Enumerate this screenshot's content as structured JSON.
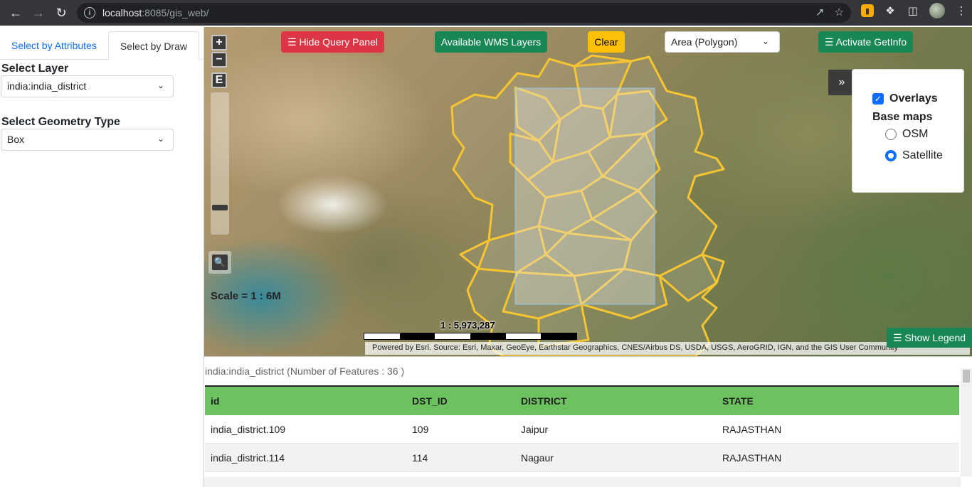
{
  "browser": {
    "url_host": "localhost",
    "url_rest": ":8085/gis_web/",
    "back_icon": "arrow-left-icon",
    "forward_icon": "arrow-right-icon",
    "reload_icon": "reload-icon"
  },
  "left_panel": {
    "tabs": [
      {
        "label": "Select by Attributes",
        "active": false
      },
      {
        "label": "Select by Draw",
        "active": true
      }
    ],
    "select_layer_label": "Select Layer",
    "select_layer_value": "india:india_district",
    "geometry_type_label": "Select Geometry Type",
    "geometry_type_value": "Box"
  },
  "map": {
    "buttons": {
      "hide_query_panel": "☰ Hide Query Panel",
      "available_wms": "Available WMS Layers",
      "clear": "Clear",
      "activate_getinfo": "☰ Activate GetInfo",
      "show_legend": "☰ Show Legend"
    },
    "draw_type_value": "Area (Polygon)",
    "zoom_in": "+",
    "zoom_out": "−",
    "extent": "E",
    "scale_text": "Scale = 1 : 6M",
    "scale_ratio": "1 : 5,973,287",
    "attribution": "Powered by Esri. Source: Esri, Maxar, GeoEye, Earthstar Geographics, CNES/Airbus DS, USDA, USGS, AeroGRID, IGN, and the GIS User Community",
    "collapse_label": "»",
    "layer_switcher": {
      "overlays_label": "Overlays",
      "overlays_checked": true,
      "basemaps_label": "Base maps",
      "options": [
        {
          "label": "OSM",
          "selected": false
        },
        {
          "label": "Satellite",
          "selected": true
        }
      ]
    }
  },
  "table": {
    "caption": "india:india_district (Number of Features : 36 )",
    "columns": [
      "id",
      "DST_ID",
      "DISTRICT",
      "STATE"
    ],
    "rows": [
      [
        "india_district.109",
        "109",
        "Jaipur",
        "RAJASTHAN"
      ],
      [
        "india_district.114",
        "114",
        "Nagaur",
        "RAJASTHAN"
      ]
    ]
  },
  "colors": {
    "district_outline": "#f7c531",
    "selection_box": "#8fc6ea",
    "header_green": "#6cc25f",
    "btn_red": "#dc3545",
    "btn_green": "#198754",
    "btn_yellow": "#ffc107"
  }
}
